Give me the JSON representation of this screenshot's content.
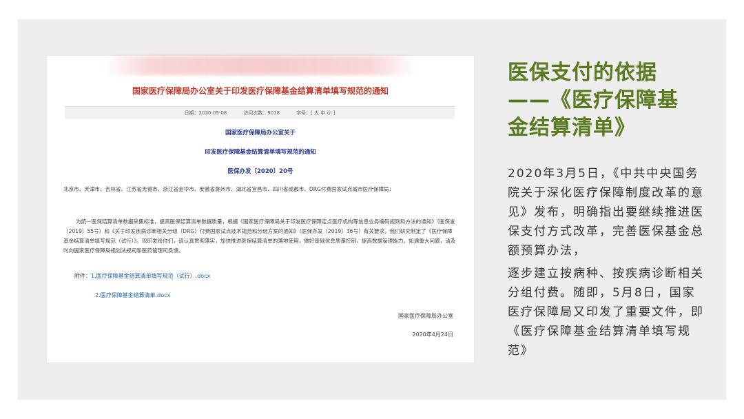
{
  "document": {
    "title": "国家医疗保障局办公室关于印发医疗保障基金结算清单填写规范的通知",
    "meta": {
      "date": "日期：2020-05-08",
      "visits": "访问次数：9018",
      "font_size": "字号：[ 大 中 小 ]"
    },
    "header_line_1": "国家医疗保障局办公室关于",
    "header_line_2": "印发医疗保障基金结算清单填写规范的通知",
    "doc_number": "医保办发〔2020〕20号",
    "recipients": "北京市、天津市、吉林省、江苏省无锡市、浙江省金华市、安徽省滁州市、湖北省宜昌市、四川省成都市、DRG付费国家试点城市医疗保障局：",
    "paragraph": "为统一医保结算清单数据采集标准，提高医保结算清单数据质量，根据《国家医疗保障局关于印发医疗保障定点医疗机构等信息业务编码规则和方法的通知》（医保发〔2019〕55号）和《关于印发疾病诊断相关分组（DRG）付费国家试点技术规范和分组方案的通知》（医保办发〔2019〕36号）有关要求，我们研究制定了《医疗保障基金结算清单填写规范（试行）》。现印发给你们，请认真贯彻落实，加快推进医保结算清单的落地使用，做好基础信息质量控制，提高数据管理能力。如遇重大问题，请及时向国家医疗保障局规划法规司和医药管理司反馈。",
    "attachments_label": "附件：",
    "attachment_1": "1.医疗保障基金结算清单填写规范（试行）.docx",
    "attachment_2": "2.医疗保障基金结算清单.docx",
    "issuer": "国家医疗保障局办公室",
    "signed_date": "2020年4月24日"
  },
  "slide": {
    "heading": "医保支付的依据——《医疗保障基金结算清单》",
    "body_1": "2020年3月5日，《中共中央国务院关于深化医疗保障制度改革的意见》发布，明确指出要继续推进医保支付方式改革，完善医保基金总额预算办法，",
    "body_2": "逐步建立按病种、按疾病诊断相关分组付费。随即，5月8日，国家医疗保障局又印发了重要文件，即《医疗保障基金结算清单填写规范》"
  },
  "colors": {
    "heading_green": "#5b7a1f",
    "doc_title_red": "#c0392b",
    "doc_header_blue": "#2b3a8f",
    "link_blue": "#1f5fb4",
    "slide_background": "#eeeeee"
  }
}
